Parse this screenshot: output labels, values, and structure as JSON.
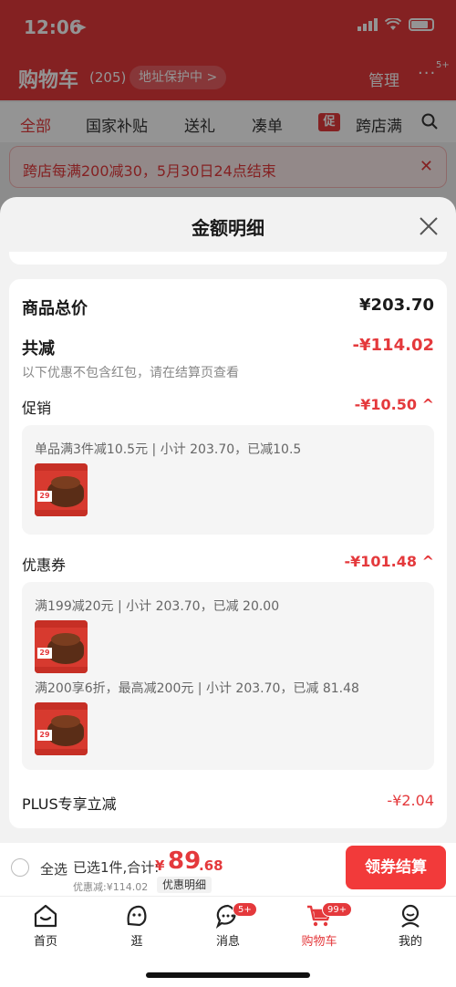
{
  "status": {
    "time": "12:06"
  },
  "header": {
    "title": "购物车",
    "count": "(205)",
    "address_pill": "地址保护中 >",
    "manage": "管理",
    "more_badge": "5+"
  },
  "tabs": [
    "全部",
    "国家补贴",
    "送礼",
    "凑单",
    "跨店满"
  ],
  "promo_badge": "促",
  "promo_banner": "跨店每满200减30，5月30日24点结束",
  "sheet": {
    "title": "金额明细",
    "total_label": "商品总价",
    "total_value": "¥203.70",
    "discount_label": "共减",
    "discount_value": "-¥114.02",
    "discount_note": "以下优惠不包含红包，请在结算页查看",
    "promo_label": "促销",
    "promo_value": "-¥10.50 ^",
    "promo_line": "单品满3件减10.5元 | 小计 203.70，已减10.5",
    "coupon_label": "优惠券",
    "coupon_value": "-¥101.48 ^",
    "coupon_line_1": "满199减20元 | 小计 203.70，已减 20.00",
    "coupon_line_2": "满200享6折，最高减200元 | 小计 203.70，已减 81.48",
    "plus_label": "PLUS专享立减",
    "plus_value": "-¥2.04",
    "thumb_price": "29"
  },
  "checkout": {
    "select_all": "全选",
    "selected_text": "已选1件,合计:",
    "yen": "¥",
    "amount_int": "89",
    "amount_dec": ".68",
    "discount_note": "优惠减:¥114.02",
    "detail_button": "优惠明细",
    "checkout_button": "领券结算"
  },
  "nav": [
    {
      "label": "首页",
      "icon": "home-icon"
    },
    {
      "label": "逛",
      "icon": "explore-icon"
    },
    {
      "label": "消息",
      "icon": "message-icon",
      "badge": "5+"
    },
    {
      "label": "购物车",
      "icon": "cart-icon",
      "badge": "99+"
    },
    {
      "label": "我的",
      "icon": "profile-icon"
    }
  ],
  "colors": {
    "brand_red": "#e4393c",
    "checkout_red": "#f23a3a"
  }
}
